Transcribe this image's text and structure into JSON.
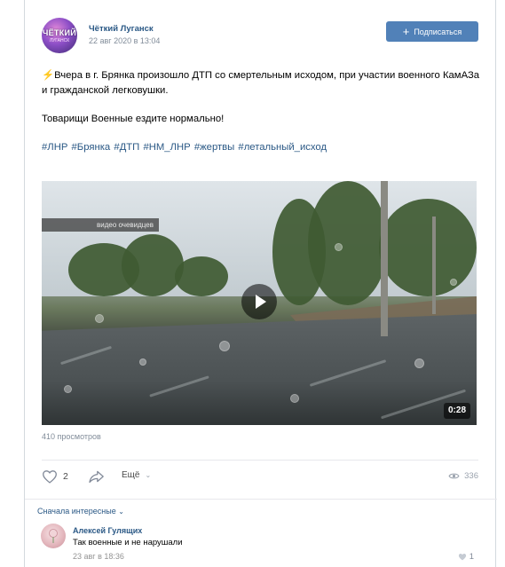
{
  "post": {
    "author": "Чёткий Луганск",
    "date": "22 авг 2020 в 13:04",
    "avatar_title": "ЧЁТКИЙ",
    "avatar_subtitle": "ЛУГАНСК",
    "subscribe_label": "Подписаться",
    "emoji": "⚡",
    "paragraph1": "Вчера в г. Брянка произошло ДТП со смертельным исходом, при участии военного КамАЗа и гражданской легковушки.",
    "paragraph2": "Товарищи Военные ездите нормально!",
    "hashtags": "#ЛНР #Брянка #ДТП #НМ_ЛНР #жертвы #летальный_исход"
  },
  "video": {
    "label": "видео очевидцев",
    "duration": "0:28",
    "views": "410 просмотров"
  },
  "actions": {
    "likes": "2",
    "more_label": "Ещё",
    "views": "336"
  },
  "comments": {
    "sort_label": "Сначала интересные",
    "items": [
      {
        "author": "Алексей Гулящих",
        "text": "Так военные и не нарушали",
        "date": "23 авг в 18:36",
        "likes": "1"
      }
    ]
  },
  "colors": {
    "link": "#2a5885",
    "button": "#5181b8",
    "meta": "#818c99"
  }
}
